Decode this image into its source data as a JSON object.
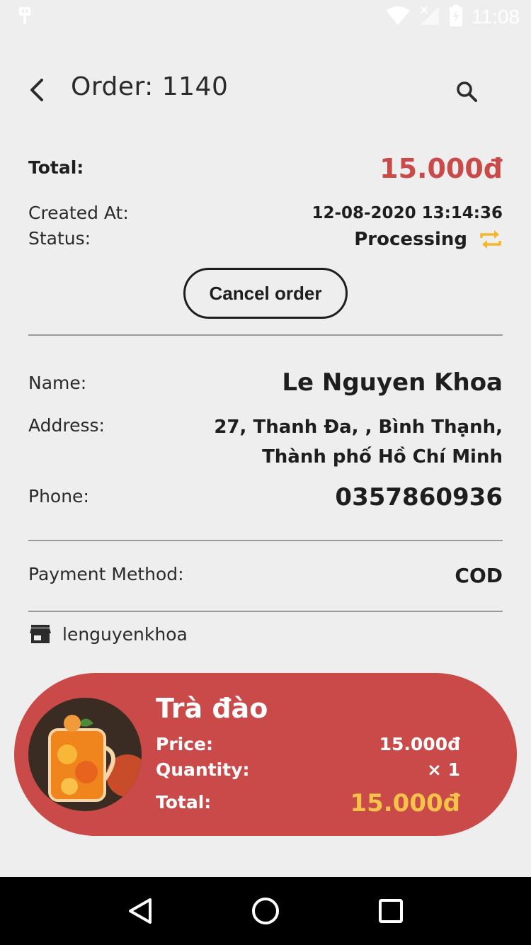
{
  "status_bar": {
    "time": "11:08"
  },
  "app_bar": {
    "title": "Order: 1140"
  },
  "summary": {
    "total_label": "Total:",
    "total_value": "15.000đ",
    "created_label": "Created At:",
    "created_value": "12-08-2020 13:14:36",
    "status_label": "Status:",
    "status_value": "Processing",
    "cancel_label": "Cancel order"
  },
  "customer": {
    "name_label": "Name:",
    "name_value": "Le Nguyen Khoa",
    "address_label": "Address:",
    "address_line1": "27, Thanh Đa, , Bình Thạnh,",
    "address_line2": "Thành phố Hồ Chí Minh",
    "phone_label": "Phone:",
    "phone_value": "0357860936"
  },
  "payment": {
    "label": "Payment Method:",
    "value": "COD"
  },
  "shop": {
    "name": "lenguyenkhoa"
  },
  "item": {
    "name": "Trà đào",
    "price_label": "Price:",
    "price_value": "15.000đ",
    "quantity_label": "Quantity:",
    "quantity_value": "× 1",
    "total_label": "Total:",
    "total_value": "15.000đ"
  },
  "colors": {
    "accent": "#c94a49",
    "highlight": "#f7c24a",
    "status_icon": "#f5b727"
  },
  "icons": [
    "back-arrow-icon",
    "search-icon",
    "repeat-icon",
    "store-icon",
    "nav-back-icon",
    "nav-home-icon",
    "nav-recents-icon"
  ]
}
